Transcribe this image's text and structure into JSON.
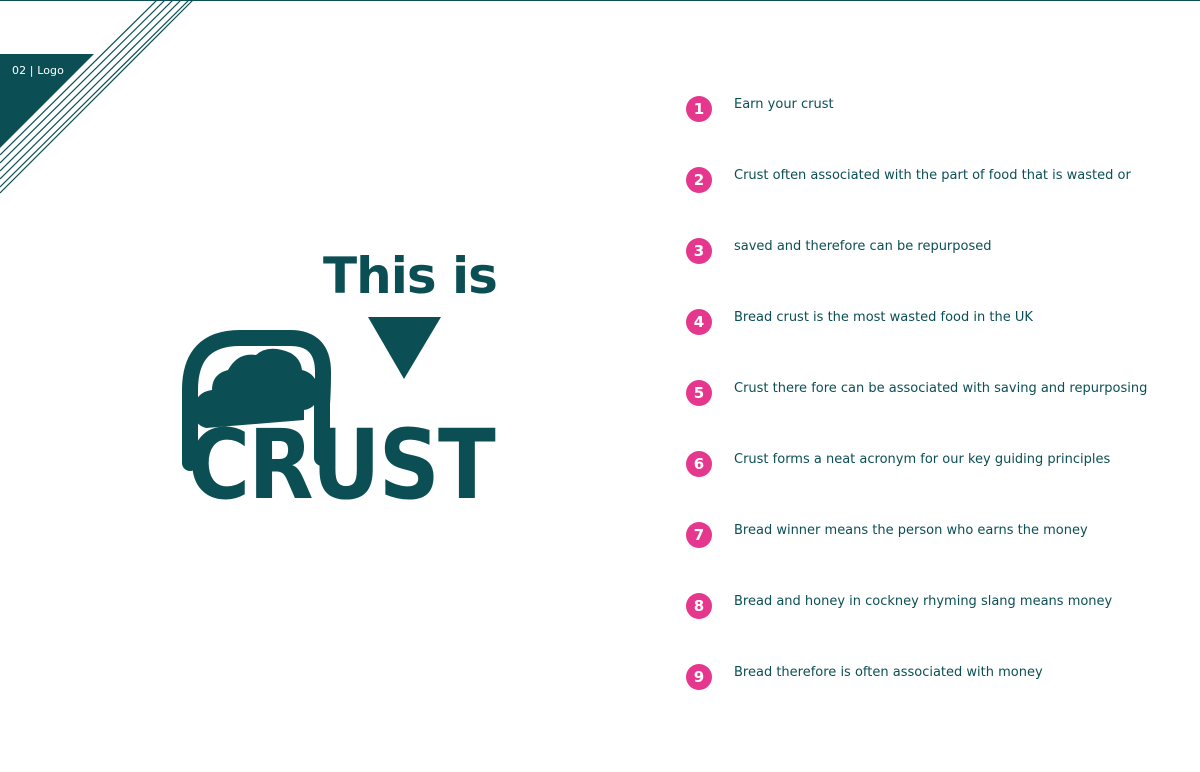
{
  "header": {
    "section_label": "02 | Logo"
  },
  "logo": {
    "tagline": "This is",
    "wordmark": "CRUST",
    "icon": "bread-loaf-icon",
    "arrow_icon": "triangle-down-icon"
  },
  "principles": [
    {
      "number": "1",
      "text": "Earn your crust"
    },
    {
      "number": "2",
      "text": "Crust often associated with the part of food that is wasted or"
    },
    {
      "number": "3",
      "text": "saved and therefore can be repurposed"
    },
    {
      "number": "4",
      "text": "Bread crust is the most wasted food in the UK"
    },
    {
      "number": "5",
      "text": "Crust there fore can be associated with saving and repurposing"
    },
    {
      "number": "6",
      "text": "Crust forms a neat acronym for our key guiding principles"
    },
    {
      "number": "7",
      "text": "Bread winner means the person who earns the money"
    },
    {
      "number": "8",
      "text": "Bread and honey in cockney rhyming slang means money"
    },
    {
      "number": "9",
      "text": "Bread therefore is often associated with money"
    }
  ],
  "colors": {
    "brand_teal": "#0b4f55",
    "accent_pink": "#e6378e",
    "background": "#ffffff"
  }
}
